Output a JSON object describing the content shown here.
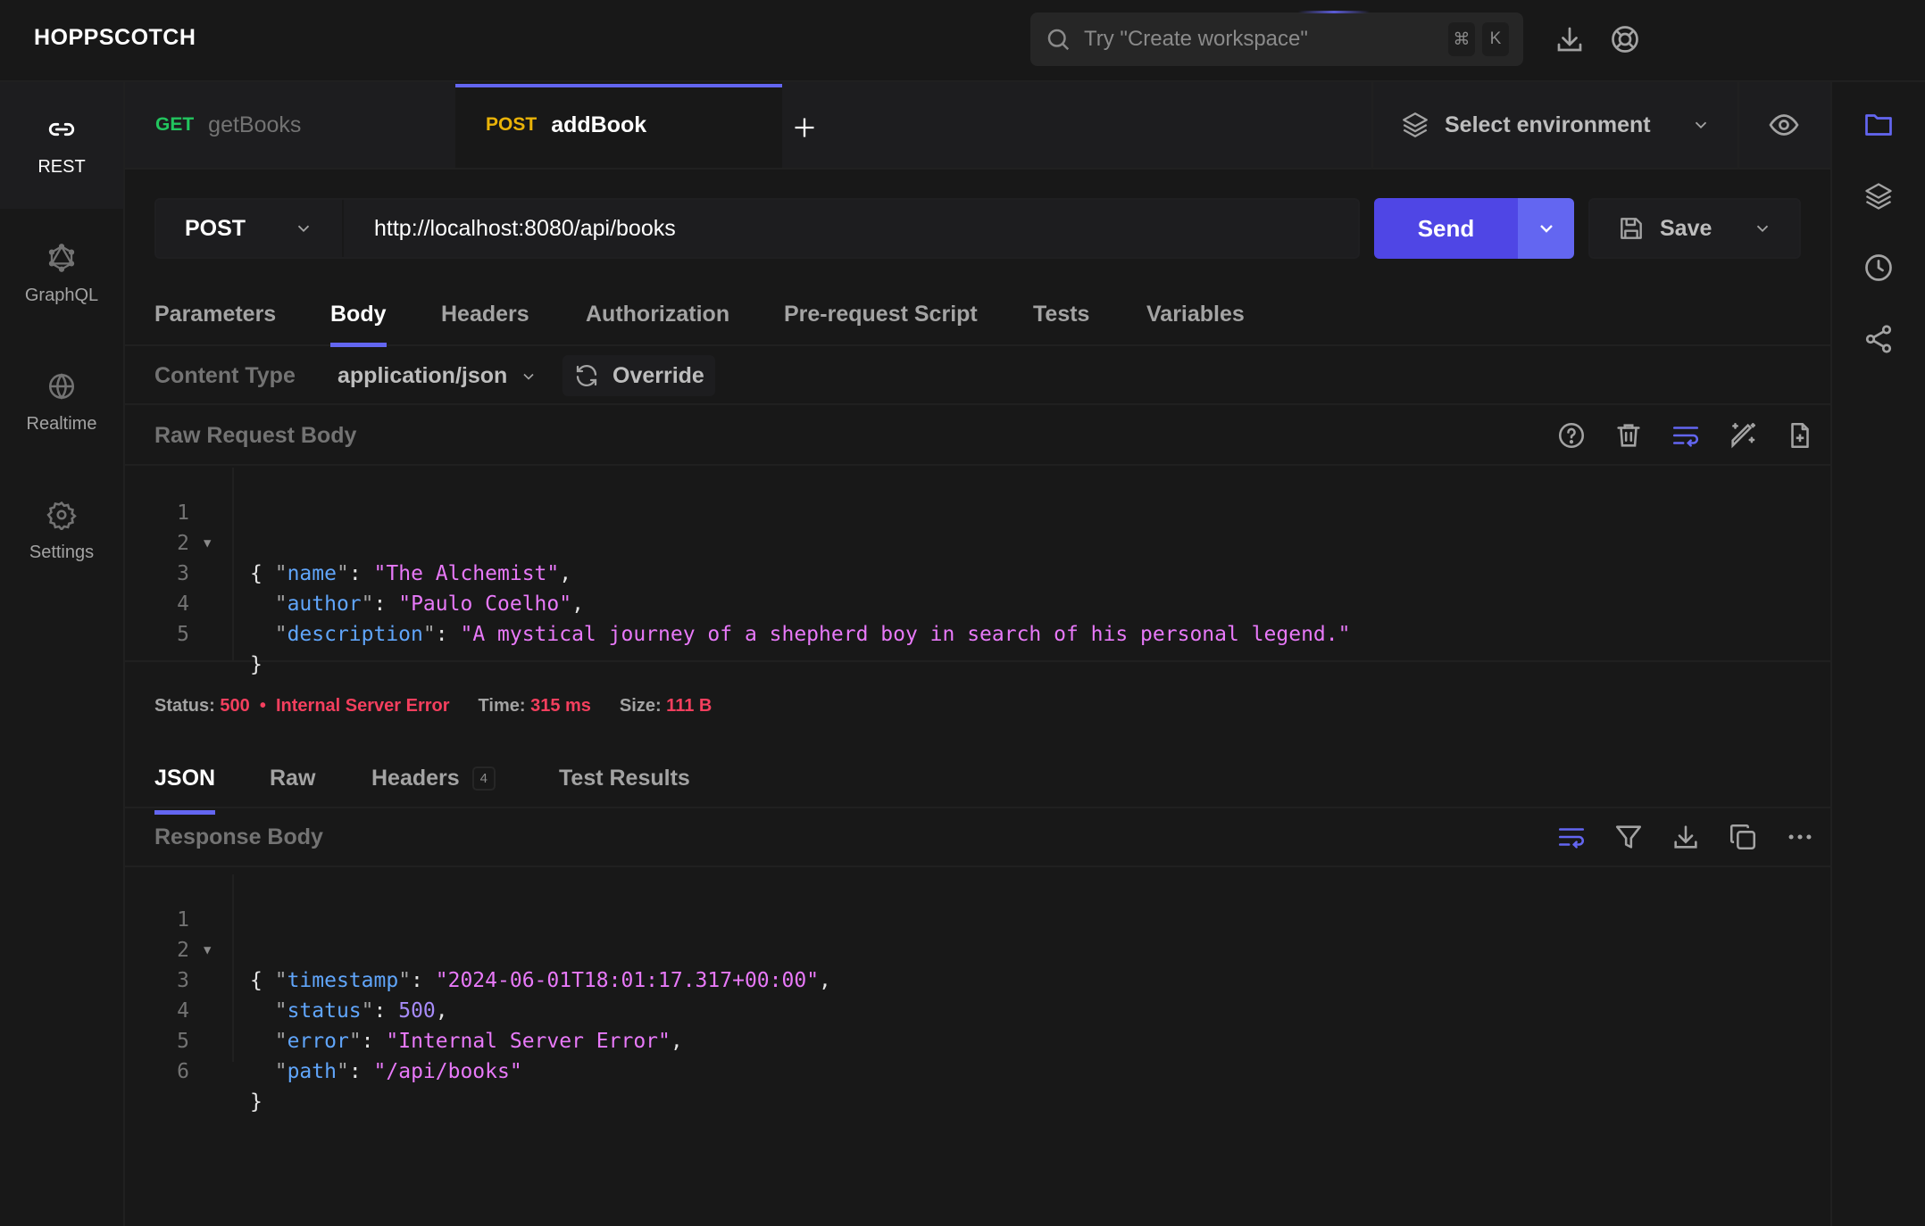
{
  "app": {
    "logo": "HOPPSCOTCH",
    "search": {
      "placeholder": "Try \"Create workspace\"",
      "shortcut": [
        "⌘",
        "K"
      ]
    },
    "top_icons": [
      "download-icon",
      "support-icon"
    ]
  },
  "left_rail": {
    "items": [
      {
        "label": "REST",
        "icon": "link-icon",
        "active": true
      },
      {
        "label": "GraphQL",
        "icon": "graphql-icon",
        "active": false
      },
      {
        "label": "Realtime",
        "icon": "globe-icon",
        "active": false
      },
      {
        "label": "Settings",
        "icon": "gear-icon",
        "active": false
      }
    ]
  },
  "right_rail": {
    "items": [
      "folder-icon",
      "layers-icon",
      "history-icon",
      "share-icon"
    ]
  },
  "request_tabs": [
    {
      "method": "GET",
      "name": "getBooks",
      "active": false,
      "method_color": "#22c55e"
    },
    {
      "method": "POST",
      "name": "addBook",
      "active": true,
      "method_color": "#eab308"
    }
  ],
  "environment": {
    "label": "Select environment"
  },
  "request": {
    "method": "POST",
    "url": "http://localhost:8080/api/books",
    "send_label": "Send",
    "save_label": "Save"
  },
  "request_subtabs": [
    {
      "label": "Parameters",
      "active": false
    },
    {
      "label": "Body",
      "active": true
    },
    {
      "label": "Headers",
      "active": false
    },
    {
      "label": "Authorization",
      "active": false
    },
    {
      "label": "Pre-request Script",
      "active": false
    },
    {
      "label": "Tests",
      "active": false
    },
    {
      "label": "Variables",
      "active": false
    }
  ],
  "content_type": {
    "label": "Content Type",
    "value": "application/json",
    "override_label": "Override"
  },
  "request_body": {
    "title": "Raw Request Body",
    "tools": [
      "help-icon",
      "trash-icon",
      "wrap-lines-icon",
      "prettify-wand-icon",
      "import-file-icon"
    ],
    "lines": [
      {
        "n": "1",
        "fold": true
      },
      {
        "n": "2",
        "key": "name",
        "value": "The Alchemist",
        "comma": true
      },
      {
        "n": "3",
        "key": "author",
        "value": "Paulo Coelho",
        "comma": true
      },
      {
        "n": "4",
        "key": "description",
        "value": "A mystical journey of a shepherd boy in search of his personal legend.",
        "comma": false
      },
      {
        "n": "5"
      }
    ],
    "open_brace": "{",
    "close_brace": "}"
  },
  "response_status": {
    "status_label": "Status:",
    "status_code": "500",
    "separator": "•",
    "status_text": "Internal Server Error",
    "time_label": "Time:",
    "time_value": "315 ms",
    "size_label": "Size:",
    "size_value": "111 B",
    "error_color": "#f43f5e"
  },
  "response_tabs": [
    {
      "label": "JSON",
      "active": true
    },
    {
      "label": "Raw",
      "active": false
    },
    {
      "label": "Headers",
      "active": false,
      "badge": "4"
    },
    {
      "label": "Test Results",
      "active": false
    }
  ],
  "response_body": {
    "title": "Response Body",
    "tools": [
      "wrap-lines-icon",
      "filter-icon",
      "download-icon",
      "copy-icon",
      "more-icon"
    ],
    "lines": [
      {
        "n": "1",
        "fold": true
      },
      {
        "n": "2",
        "key": "timestamp",
        "value": "2024-06-01T18:01:17.317+00:00",
        "comma": true
      },
      {
        "n": "3",
        "key": "status",
        "number": "500",
        "comma": true
      },
      {
        "n": "4",
        "key": "error",
        "value": "Internal Server Error",
        "comma": true
      },
      {
        "n": "5",
        "key": "path",
        "value": "/api/books",
        "comma": false
      },
      {
        "n": "6"
      }
    ],
    "open_brace": "{",
    "close_brace": "}"
  },
  "colors": {
    "accent": "#6366f1",
    "send": "#4f46e5",
    "key": "#60a5fa",
    "string": "#e879f9",
    "number": "#a78bfa"
  }
}
